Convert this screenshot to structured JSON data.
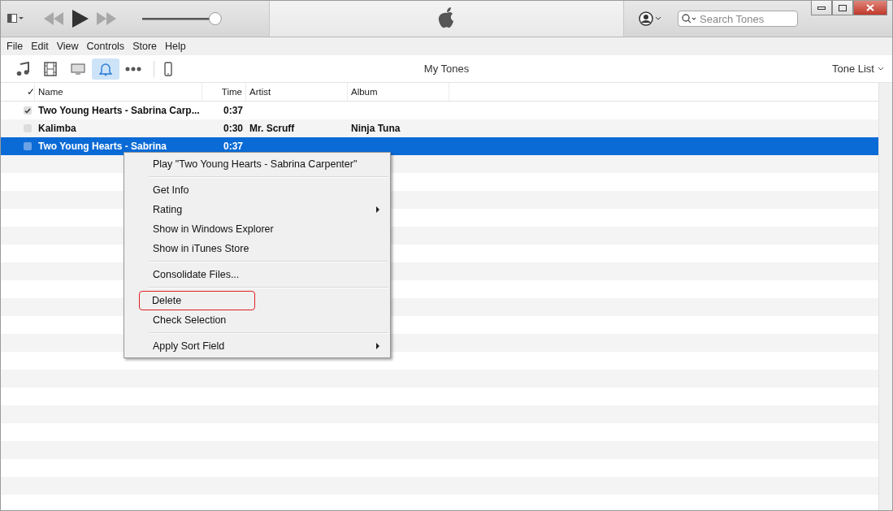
{
  "volume": {
    "level": 0.93
  },
  "search": {
    "placeholder": "Search Tones"
  },
  "menu_bar": [
    "File",
    "Edit",
    "View",
    "Controls",
    "Store",
    "Help"
  ],
  "media_tabs": [
    {
      "kind": "music",
      "selected": false
    },
    {
      "kind": "movies",
      "selected": false
    },
    {
      "kind": "tv",
      "selected": false
    },
    {
      "kind": "tones",
      "selected": true
    },
    {
      "kind": "more",
      "selected": false
    }
  ],
  "library_title": "My Tones",
  "view_menu": "Tone List",
  "table": {
    "columns": [
      "✓",
      "Name",
      "Time",
      "Artist",
      "Album"
    ],
    "rows": [
      {
        "checked": true,
        "selected": false,
        "name": "Two Young Hearts - Sabrina Carp...",
        "time": "0:37",
        "artist": "",
        "album": ""
      },
      {
        "checked": false,
        "selected": false,
        "name": "Kalimba",
        "time": "0:30",
        "artist": "Mr. Scruff",
        "album": "Ninja Tuna"
      },
      {
        "checked": false,
        "selected": true,
        "name": "Two Young Hearts - Sabrina",
        "time": "0:37",
        "artist": "",
        "album": ""
      }
    ]
  },
  "context_menu": [
    {
      "kind": "item",
      "label": "Play \"Two Young Hearts - Sabrina Carpenter\"",
      "submenu": false,
      "highlighted": false
    },
    {
      "kind": "separator"
    },
    {
      "kind": "item",
      "label": "Get Info",
      "submenu": false,
      "highlighted": false
    },
    {
      "kind": "item",
      "label": "Rating",
      "submenu": true,
      "highlighted": false
    },
    {
      "kind": "item",
      "label": "Show in Windows Explorer",
      "submenu": false,
      "highlighted": false
    },
    {
      "kind": "item",
      "label": "Show in iTunes Store",
      "submenu": false,
      "highlighted": false
    },
    {
      "kind": "separator"
    },
    {
      "kind": "item",
      "label": "Consolidate Files...",
      "submenu": false,
      "highlighted": false
    },
    {
      "kind": "separator"
    },
    {
      "kind": "item",
      "label": "Delete",
      "submenu": false,
      "highlighted": true
    },
    {
      "kind": "item",
      "label": "Check Selection",
      "submenu": false,
      "highlighted": false
    },
    {
      "kind": "separator"
    },
    {
      "kind": "item",
      "label": "Apply Sort Field",
      "submenu": true,
      "highlighted": false
    }
  ]
}
